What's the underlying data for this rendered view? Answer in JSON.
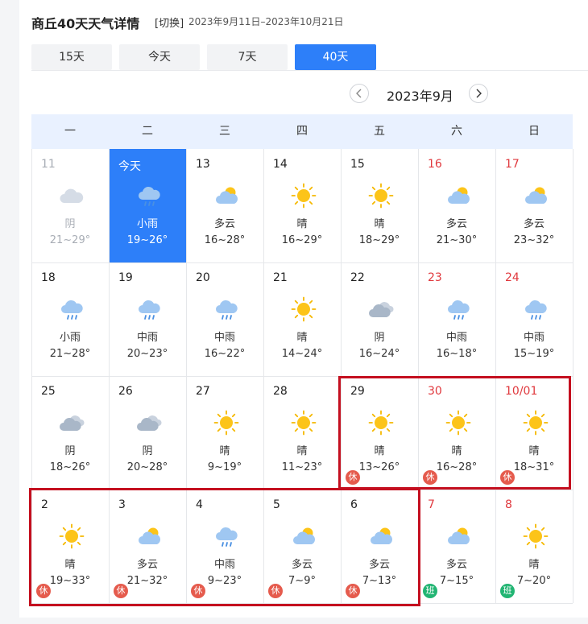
{
  "header": {
    "title": "商丘40天天气详情",
    "switch_label": "[切换]",
    "date_range": "2023年9月11日–2023年10月21日"
  },
  "tabs": [
    {
      "label": "15天"
    },
    {
      "label": "今天"
    },
    {
      "label": "7天"
    },
    {
      "label": "40天",
      "active": true
    }
  ],
  "calendar": {
    "month": "2023年9月",
    "weekdays": [
      "一",
      "二",
      "三",
      "四",
      "五",
      "六",
      "日"
    ],
    "rest_label": "休",
    "work_label": "班",
    "days": [
      {
        "date": "11",
        "weather": "阴",
        "temp": "21~29°",
        "icon": "overcast",
        "style": "past"
      },
      {
        "date": "今天",
        "weather": "小雨",
        "temp": "19~26°",
        "icon": "rain",
        "style": "today"
      },
      {
        "date": "13",
        "weather": "多云",
        "temp": "16~28°",
        "icon": "cloudy"
      },
      {
        "date": "14",
        "weather": "晴",
        "temp": "16~29°",
        "icon": "sun"
      },
      {
        "date": "15",
        "weather": "晴",
        "temp": "18~29°",
        "icon": "sun"
      },
      {
        "date": "16",
        "weather": "多云",
        "temp": "21~30°",
        "icon": "cloudy",
        "red": true
      },
      {
        "date": "17",
        "weather": "多云",
        "temp": "23~32°",
        "icon": "cloudy",
        "red": true
      },
      {
        "date": "18",
        "weather": "小雨",
        "temp": "21~28°",
        "icon": "rain"
      },
      {
        "date": "19",
        "weather": "中雨",
        "temp": "20~23°",
        "icon": "rain"
      },
      {
        "date": "20",
        "weather": "中雨",
        "temp": "16~22°",
        "icon": "rain"
      },
      {
        "date": "21",
        "weather": "晴",
        "temp": "14~24°",
        "icon": "sun"
      },
      {
        "date": "22",
        "weather": "阴",
        "temp": "16~24°",
        "icon": "overcast-dark"
      },
      {
        "date": "23",
        "weather": "中雨",
        "temp": "16~18°",
        "icon": "rain",
        "red": true
      },
      {
        "date": "24",
        "weather": "中雨",
        "temp": "15~19°",
        "icon": "rain",
        "red": true
      },
      {
        "date": "25",
        "weather": "阴",
        "temp": "18~26°",
        "icon": "overcast-dark"
      },
      {
        "date": "26",
        "weather": "阴",
        "temp": "20~28°",
        "icon": "overcast-dark"
      },
      {
        "date": "27",
        "weather": "晴",
        "temp": "9~19°",
        "icon": "sun"
      },
      {
        "date": "28",
        "weather": "晴",
        "temp": "11~23°",
        "icon": "sun"
      },
      {
        "date": "29",
        "weather": "晴",
        "temp": "13~26°",
        "icon": "sun",
        "badge": "rest"
      },
      {
        "date": "30",
        "weather": "晴",
        "temp": "16~28°",
        "icon": "sun",
        "red": true,
        "badge": "rest"
      },
      {
        "date": "10/01",
        "weather": "晴",
        "temp": "18~31°",
        "icon": "sun",
        "red": true,
        "badge": "rest"
      },
      {
        "date": "2",
        "weather": "晴",
        "temp": "19~33°",
        "icon": "sun",
        "badge": "rest"
      },
      {
        "date": "3",
        "weather": "多云",
        "temp": "21~32°",
        "icon": "cloudy",
        "badge": "rest"
      },
      {
        "date": "4",
        "weather": "中雨",
        "temp": "9~23°",
        "icon": "rain",
        "badge": "rest"
      },
      {
        "date": "5",
        "weather": "多云",
        "temp": "7~9°",
        "icon": "cloudy",
        "badge": "rest"
      },
      {
        "date": "6",
        "weather": "多云",
        "temp": "7~13°",
        "icon": "cloudy",
        "badge": "rest"
      },
      {
        "date": "7",
        "weather": "多云",
        "temp": "7~15°",
        "icon": "cloudy",
        "red": true,
        "badge": "work"
      },
      {
        "date": "8",
        "weather": "晴",
        "temp": "7~20°",
        "icon": "sun",
        "red": true,
        "badge": "work"
      }
    ]
  },
  "colors": {
    "accent": "#2d7ff9",
    "holiday_red": "#e0393e",
    "rest_badge": "#e55b4d",
    "work_badge": "#22b573",
    "highlight_border": "#c40f1f",
    "header_bg": "#e9f1ff"
  }
}
